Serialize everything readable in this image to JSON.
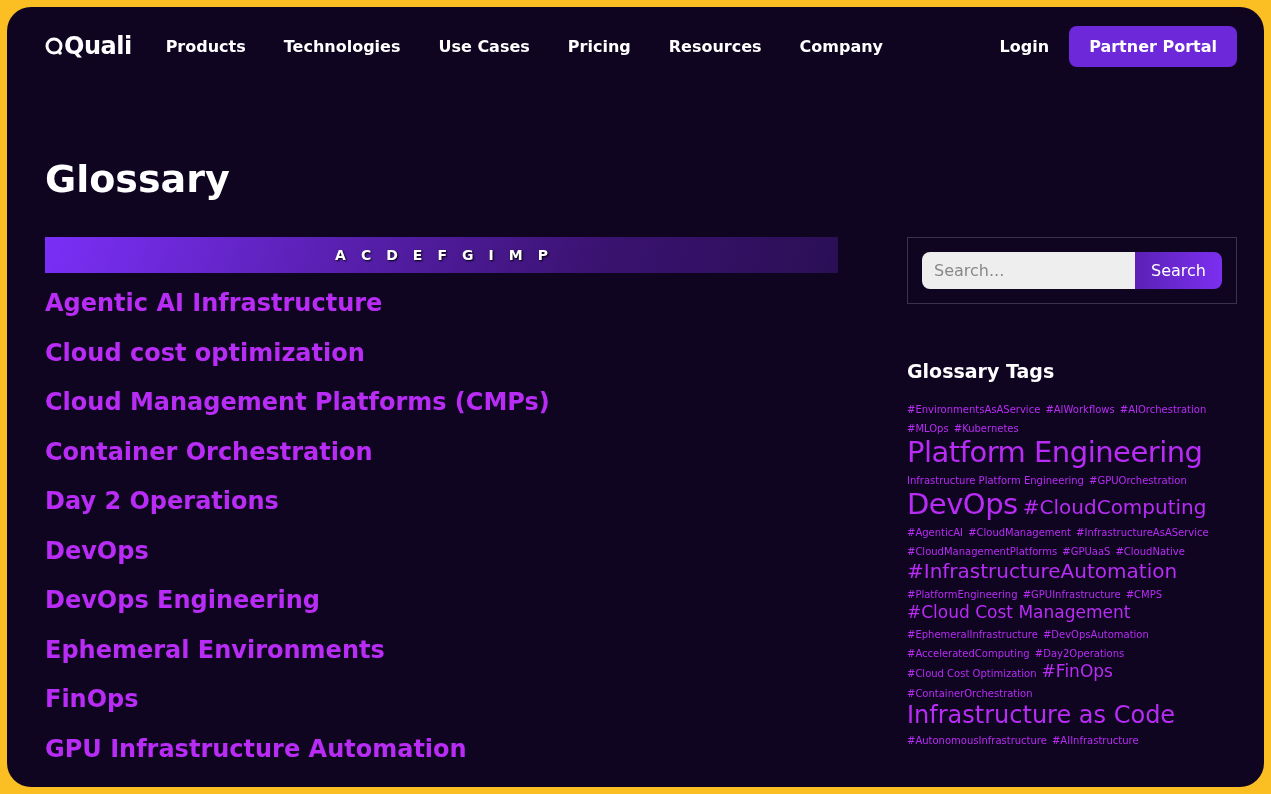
{
  "nav": {
    "logo": "Quali",
    "links": [
      "Products",
      "Technologies",
      "Use Cases",
      "Pricing",
      "Resources",
      "Company"
    ],
    "login": "Login",
    "cta": "Partner Portal"
  },
  "title": "Glossary",
  "letters": [
    "A",
    "C",
    "D",
    "E",
    "F",
    "G",
    "I",
    "M",
    "P"
  ],
  "terms": [
    "Agentic AI Infrastructure",
    "Cloud cost optimization",
    "Cloud Management Platforms (CMPs)",
    "Container Orchestration",
    "Day 2 Operations",
    "DevOps",
    "DevOps Engineering",
    "Ephemeral Environments",
    "FinOps",
    "GPU Infrastructure Automation"
  ],
  "search": {
    "placeholder": "Search...",
    "button": "Search"
  },
  "tags_title": "Glossary Tags",
  "tags": [
    {
      "text": "#EnvironmentsAsAService",
      "kind": "small"
    },
    {
      "text": "#AIWorkflows",
      "kind": "small"
    },
    {
      "text": "#AIOrchestration",
      "kind": "small"
    },
    {
      "text": "#MLOps",
      "kind": "small"
    },
    {
      "text": "#Kubernetes",
      "kind": "small"
    },
    {
      "text": "Platform Engineering",
      "kind": "huge"
    },
    {
      "text": "Infrastructure Platform Engineering",
      "kind": "small"
    },
    {
      "text": "#GPUOrchestration",
      "kind": "small"
    },
    {
      "text": "DevOps",
      "kind": "huge"
    },
    {
      "text": "#CloudComputing",
      "kind": "large"
    },
    {
      "text": "#AgenticAI",
      "kind": "small"
    },
    {
      "text": "#CloudManagement",
      "kind": "small"
    },
    {
      "text": "#InfrastructureAsAService",
      "kind": "small"
    },
    {
      "text": "#CloudManagementPlatforms",
      "kind": "small"
    },
    {
      "text": "#GPUaaS",
      "kind": "small"
    },
    {
      "text": "#CloudNative",
      "kind": "small"
    },
    {
      "text": "#InfrastructureAutomation",
      "kind": "large"
    },
    {
      "text": "#PlatformEngineering",
      "kind": "small"
    },
    {
      "text": "#GPUInfrastructure",
      "kind": "small"
    },
    {
      "text": "#CMPS",
      "kind": "small"
    },
    {
      "text": "#Cloud Cost Management",
      "kind": "medium"
    },
    {
      "text": "#EphemeralInfrastructure",
      "kind": "small"
    },
    {
      "text": "#DevOpsAutomation",
      "kind": "small"
    },
    {
      "text": "#AcceleratedComputing",
      "kind": "small"
    },
    {
      "text": "#Day2Operations",
      "kind": "small"
    },
    {
      "text": "#Cloud Cost Optimization",
      "kind": "small"
    },
    {
      "text": "#FinOps",
      "kind": "medium"
    },
    {
      "text": "#ContainerOrchestration",
      "kind": "small"
    },
    {
      "text": "Infrastructure as Code",
      "kind": "xlarge"
    },
    {
      "text": "#AutonomousInfrastructure",
      "kind": "small"
    },
    {
      "text": "#AIInfrastructure",
      "kind": "small"
    }
  ]
}
